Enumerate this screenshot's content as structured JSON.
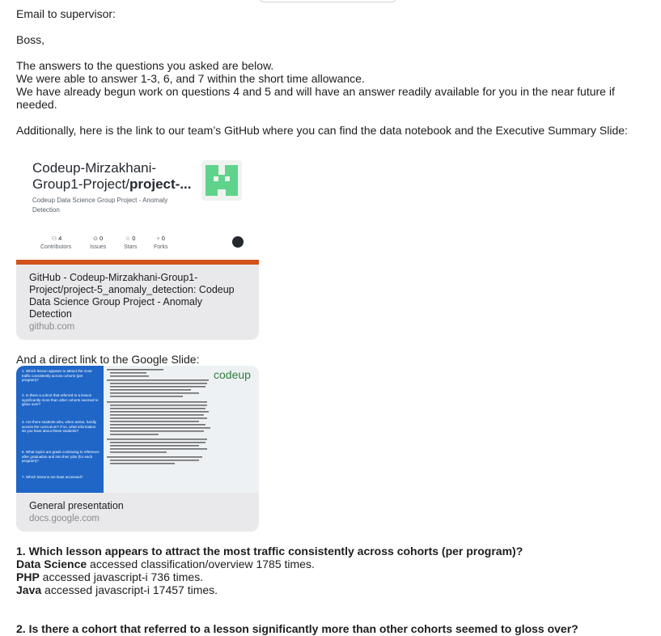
{
  "email": {
    "heading": "Email to supervisor:",
    "greeting": "Boss,",
    "para1": [
      "The answers to the questions you asked are below.",
      "We were able to answer 1-3, 6, and 7 within the short time allowance.",
      "We have already begun work on questions 4 and 5 and will have an answer readily available for you in the near future if needed."
    ],
    "github_intro": "Additionally, here is the link to our team’s GitHub where you can find the data notebook and the Executive Summary Slide:",
    "slide_intro": "And a direct link to the Google Slide:"
  },
  "github_card": {
    "repo_line1": "Codeup-Mirzakhani-",
    "repo_line2_prefix": "Group1-Project/",
    "repo_line2_bold": "project-...",
    "description": "Codeup Data Science Group Project - Anomaly Detection",
    "stats": [
      {
        "value": "4",
        "label": "Contributors",
        "icon": "people-icon"
      },
      {
        "value": "0",
        "label": "Issues",
        "icon": "issue-icon"
      },
      {
        "value": "0",
        "label": "Stars",
        "icon": "star-icon"
      },
      {
        "value": "0",
        "label": "Forks",
        "icon": "fork-icon"
      }
    ],
    "title": "GitHub - Codeup-Mirzakhani-Group1-Project/project-5_anomaly_detection: Codeup Data Science Group Project - Anomaly Detection",
    "domain": "github.com",
    "accent_color": "#d2521c"
  },
  "slide_card": {
    "logo": "codeup",
    "left_questions": [
      "1. Which lesson appears to attract the most traffic consistently across cohorts (per program)?",
      "2. Is there a cohort that referred to a lesson significantly more than other cohorts seemed to gloss over?",
      "3. Are there students who, when active, hardly access the curriculum? If so, what information do you have about these students?",
      "6. What topics are grads continuing to reference after graduation and into their jobs (for each program)?",
      "7. Which lessons are least accessed?"
    ],
    "title": "General presentation",
    "domain": "docs.google.com",
    "left_color": "#1f66c7"
  },
  "answers": {
    "q1": "1. Which lesson appears to attract the most traffic consistently across cohorts (per program)?",
    "rows": [
      {
        "program": "Data Science",
        "text": " accessed classification/overview 1785 times."
      },
      {
        "program": "PHP",
        "text": " accessed javascript-i 736 times."
      },
      {
        "program": "Java",
        "text": " accessed javascript-i 17457 times."
      }
    ],
    "q2": "2. Is there a cohort that referred to a lesson significantly more than other cohorts seemed to gloss over?"
  }
}
